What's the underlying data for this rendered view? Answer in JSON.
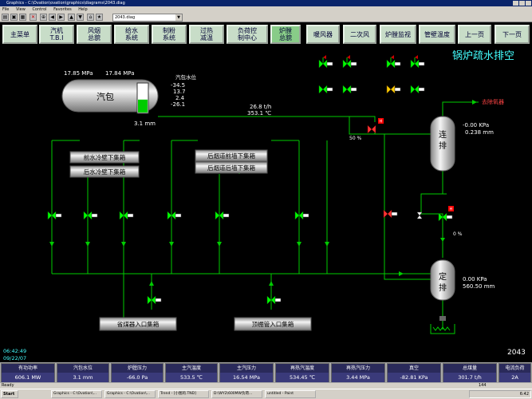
{
  "window": {
    "title": "Graphics - C:\\Ovation\\ovation\\graphics\\diagrams\\2043.diag",
    "menu": [
      "File",
      "View",
      "Control",
      "Favorites",
      "Help"
    ]
  },
  "toolbar": {
    "diagram_select": "2043.diag"
  },
  "nav": {
    "buttons": [
      {
        "label": "主菜单"
      },
      {
        "label": "汽机\nT.B.I"
      },
      {
        "label": "风烟\n总貌"
      },
      {
        "label": "给水\n系统"
      },
      {
        "label": "制粉\n系统"
      },
      {
        "label": "过热\n减温"
      },
      {
        "label": "负荷控\n制中心"
      },
      {
        "label": "炉膛\n总貌"
      },
      {
        "label": "暖风器"
      },
      {
        "label": "二次风"
      },
      {
        "label": "炉膛监视"
      },
      {
        "label": "管壁温度"
      },
      {
        "label": "上一页"
      },
      {
        "label": "下一页"
      }
    ]
  },
  "diagram": {
    "title": "锅炉疏水排空",
    "drum": {
      "label": "汽包",
      "pressure_a": "17.85 MPa",
      "pressure_b": "17.84 MPa",
      "level_title": "汽包水位",
      "levels": [
        "-34.5",
        "13.7",
        "2.4",
        "-26.1"
      ],
      "level_value": "3.1 mm",
      "gauge_fill": 0.45
    },
    "flow": "26.8  t/h",
    "temp": "353.1  ℃",
    "valve_percent": "50 %",
    "valve2_percent": "0 %",
    "to_deaerator": "去除氧器",
    "cont_blowdown": {
      "label": "连\n排",
      "pressure": "-0.00 KPa",
      "level": "0.238  mm"
    },
    "periodic_blowdown": {
      "label": "定\n排",
      "pressure": "0.00 KPa",
      "level": "560.50  mm"
    },
    "headers": {
      "front_wall": "前水冷壁下集箱",
      "rear_wall": "后水冷壁下集箱",
      "rear_flue_front": "后烟道前墙下集箱",
      "rear_flue_rear": "后烟道后墙下集箱",
      "economizer": "省煤器入口集箱",
      "roof": "顶棚管入口集箱"
    },
    "time": "06:42:49",
    "date": "09/22/07",
    "page_no": "2043"
  },
  "status": [
    {
      "label": "有功功率",
      "value": "606.1 MW"
    },
    {
      "label": "汽包水位",
      "value": "3.1 mm"
    },
    {
      "label": "炉膛压力",
      "value": "-66.0 Pa"
    },
    {
      "label": "主汽温度",
      "value": "533.5 ℃"
    },
    {
      "label": "主汽压力",
      "value": "16.54 MPa"
    },
    {
      "label": "再热汽温度",
      "value": "534.45 ℃"
    },
    {
      "label": "再热汽压力",
      "value": "3.44 MPa"
    },
    {
      "label": "真空",
      "value": "-82.81 KPa"
    },
    {
      "label": "总煤量",
      "value": "301.7 t/h"
    },
    {
      "label": "电流负荷",
      "value": "2A"
    }
  ],
  "statusbar": {
    "ready": "Ready",
    "num": "144"
  },
  "taskbar": {
    "start": "Start",
    "tasks": [
      "Graphics - C:\\Ovation\\...",
      "Graphics - C:\\Ovation\\...",
      "Trend - [小图的.TND]",
      "D:\\WY2\\600MW负荷...",
      "untitled - Paint"
    ],
    "clock": "6:42"
  },
  "colors": {
    "pipe": "#00cc00",
    "valve_green": "#00ff00",
    "valve_red": "#ff3333",
    "text_cyan": "#44ffff",
    "flag_red": "#cc0000"
  }
}
